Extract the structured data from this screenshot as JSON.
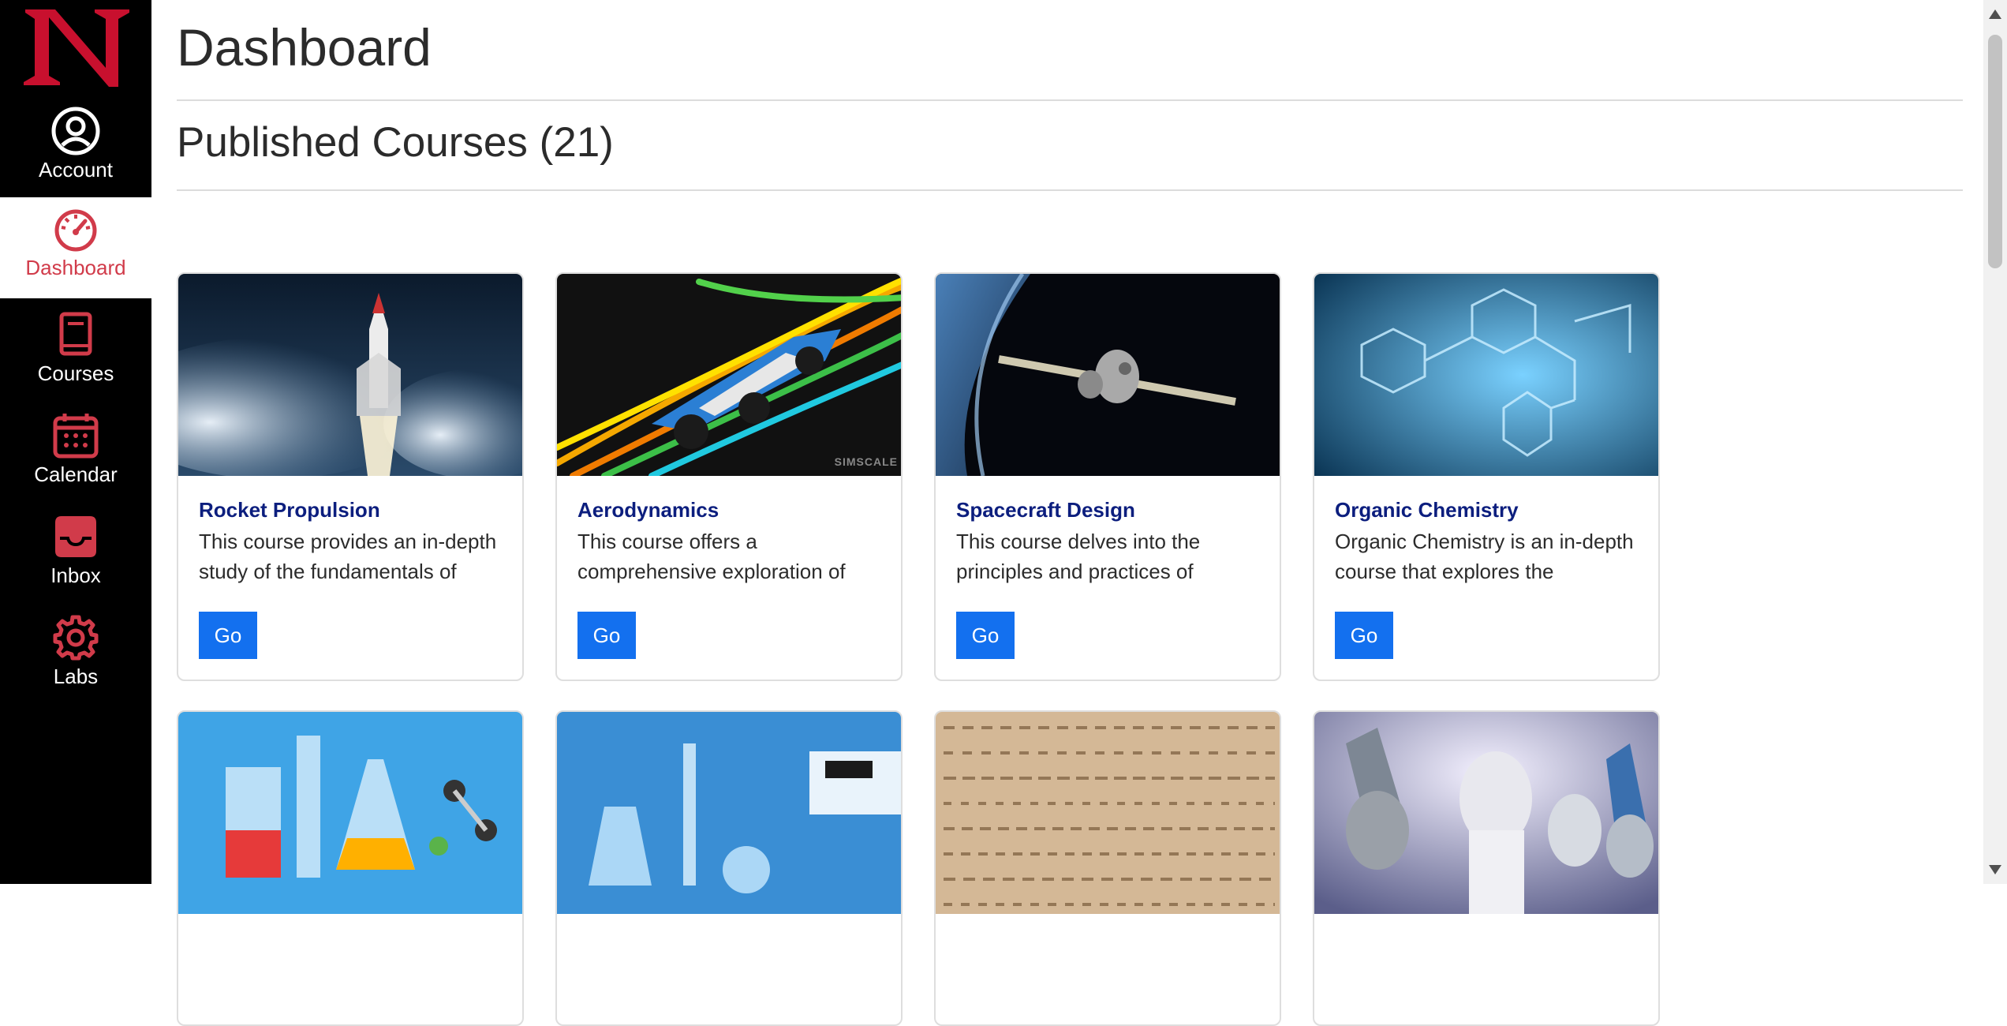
{
  "sidebar": {
    "logo_letter": "N",
    "items": [
      {
        "label": "Account",
        "icon": "account-circle-icon"
      },
      {
        "label": "Dashboard",
        "icon": "speedometer-icon",
        "active": true
      },
      {
        "label": "Courses",
        "icon": "book-icon"
      },
      {
        "label": "Calendar",
        "icon": "calendar-icon"
      },
      {
        "label": "Inbox",
        "icon": "inbox-tray-icon"
      },
      {
        "label": "Labs",
        "icon": "gear-icon"
      }
    ]
  },
  "header": {
    "title": "Dashboard"
  },
  "section": {
    "title": "Published Courses (21)"
  },
  "courses": [
    {
      "title": "Rocket Propulsion",
      "desc": "This course provides an in-depth study of the fundamentals of",
      "button": "Go"
    },
    {
      "title": "Aerodynamics",
      "desc": "This course offers a comprehensive exploration of",
      "button": "Go",
      "watermark": "SIMSCALE"
    },
    {
      "title": "Spacecraft Design",
      "desc": "This course delves into the principles and practices of",
      "button": "Go"
    },
    {
      "title": "Organic Chemistry",
      "desc": "Organic Chemistry is an in-depth course that explores the structure,",
      "button": "Go"
    }
  ],
  "colors": {
    "sidebar_bg": "#000000",
    "accent_red": "#d13b4a",
    "link_navy": "#0c1e7e",
    "button_blue": "#1370ef"
  }
}
